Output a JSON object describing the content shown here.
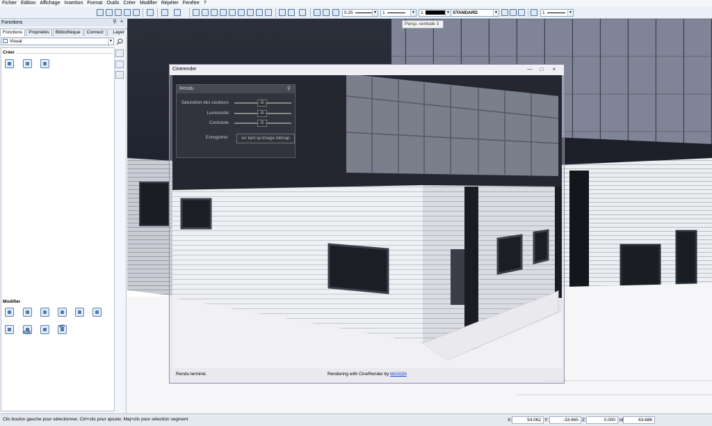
{
  "menu": [
    "Fichier",
    "Edition",
    "Affichage",
    "Insertion",
    "Format",
    "Outils",
    "Créer",
    "Modifier",
    "Répéter",
    "Fenêtre",
    "?"
  ],
  "toolbar": {
    "pen_value": "0.25",
    "line_value": "1",
    "color_value": "1",
    "layer_value": "STANDARD",
    "pattern_value": "1"
  },
  "tooltip": "Persp. centrale 3",
  "left_panel": {
    "title": "Fonctions",
    "pin": "⚲",
    "close": "×",
    "tabs": [
      "Fonctions",
      "Propriétés",
      "Bibliothèque",
      "Connect",
      "Layer"
    ],
    "active_tab": "Fonctions",
    "visual_combo": "Visual",
    "section_create": "Créer",
    "section_modify": "Modifier",
    "modify_icons": [
      "",
      "",
      "",
      "",
      "",
      "",
      "",
      "RGB",
      "",
      "4D"
    ]
  },
  "cinerender": {
    "title": "Cinerender",
    "buttons": {
      "minimize": "—",
      "maximize": "□",
      "close": "×"
    },
    "panel_title": "Rendu",
    "sliders": [
      {
        "label": "Saturation des couleurs",
        "value": "0"
      },
      {
        "label": "Luminosité",
        "value": "0"
      },
      {
        "label": "Contraste",
        "value": "0"
      }
    ],
    "save_label": "Enregistrer",
    "save_button": "en tant qu'image bitmap",
    "status_left": "Rendu terminé.",
    "status_center": "Rendering with CineRender by",
    "status_link": "MAXON"
  },
  "status": {
    "message": "Clic bouton gauche pour sélectionner, Ctrl+clic pour ajouter, Maj+clic pour sélection segment",
    "x_label": "X:",
    "x_value": "54.062",
    "y_label": "Y:",
    "y_value": "-33.665",
    "z_label": "Z:",
    "z_value": "0.000",
    "d_label": "ld:",
    "d_value": "63.686"
  }
}
